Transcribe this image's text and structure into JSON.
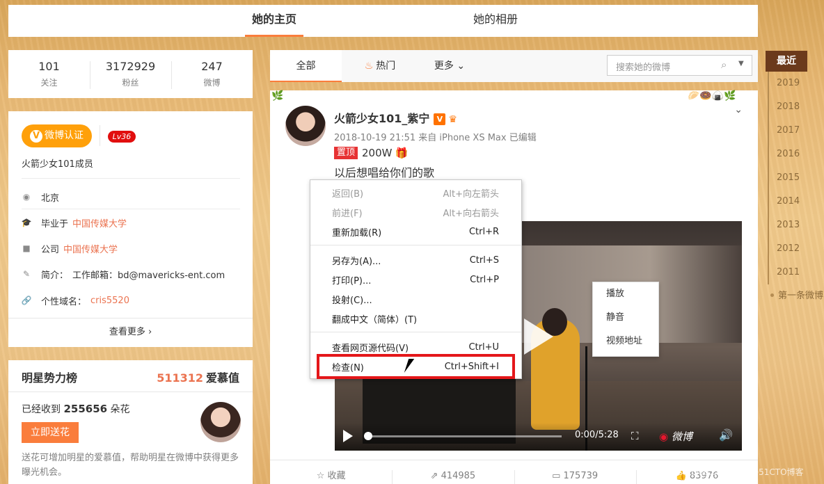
{
  "nav": {
    "tab_home": "她的主页",
    "tab_album": "她的相册"
  },
  "stats": [
    {
      "num": "101",
      "label": "关注"
    },
    {
      "num": "3172929",
      "label": "粉丝"
    },
    {
      "num": "247",
      "label": "微博"
    }
  ],
  "profile": {
    "badge": "微博认证",
    "badge_icon": "V",
    "level": "Lv36",
    "desc": "火箭少女101成员",
    "location": "北京",
    "edu_prefix": "毕业于",
    "edu_link": "中国传媒大学",
    "company_prefix": "公司",
    "company_link": "中国传媒大学",
    "intro_label": "简介：",
    "intro_value": "工作邮箱：bd@mavericks-ent.com",
    "domain_label": "个性域名：",
    "domain_value": "cris5520",
    "more": "查看更多"
  },
  "rank": {
    "title": "明星势力榜",
    "score": "511312",
    "score_unit": "爱慕值",
    "received_prefix": "已经收到",
    "received_num": "255656",
    "received_unit": "朵花",
    "send_button": "立即送花",
    "tip": "送花可增加明星的爱慕值，帮助明星在微博中获得更多曝光机会。"
  },
  "feed_tabs": {
    "all": "全部",
    "hot": "热门",
    "more": "更多"
  },
  "search": {
    "placeholder": "搜索她的微博"
  },
  "post": {
    "name": "火箭少女101_紫宁",
    "v": "V",
    "meta": "2018-10-19 21:51 来自 iPhone XS Max  已编辑",
    "pinned": "置顶",
    "count": "200W",
    "text": "以后想唱给你们的歌",
    "video_time": "0:00/5:28",
    "video_logo": "微博",
    "actions": [
      {
        "icon": "☆",
        "label": "收藏"
      },
      {
        "icon": "⇗",
        "label": "414985"
      },
      {
        "icon": "▭",
        "label": "175739"
      },
      {
        "icon": "👍",
        "label": "83976"
      }
    ]
  },
  "video_menu": [
    "播放",
    "静音",
    "视频地址"
  ],
  "context_menu": {
    "back": {
      "label": "返回(B)",
      "key": "Alt+向左箭头"
    },
    "forward": {
      "label": "前进(F)",
      "key": "Alt+向右箭头"
    },
    "reload": {
      "label": "重新加载(R)",
      "key": "Ctrl+R"
    },
    "saveas": {
      "label": "另存为(A)...",
      "key": "Ctrl+S"
    },
    "print": {
      "label": "打印(P)...",
      "key": "Ctrl+P"
    },
    "cast": {
      "label": "投射(C)..."
    },
    "translate": {
      "label": "翻成中文（简体）(T)"
    },
    "source": {
      "label": "查看网页源代码(V)",
      "key": "Ctrl+U"
    },
    "inspect": {
      "label": "检查(N)",
      "key": "Ctrl+Shift+I"
    }
  },
  "years": [
    "最近",
    "2019",
    "2018",
    "2017",
    "2016",
    "2015",
    "2014",
    "2013",
    "2012",
    "2011",
    "第一条微博"
  ],
  "watermark": "https://blog.csdn.net @51CTO博客",
  "colors": {
    "accent": "#fa7d3c",
    "link": "#eb7350",
    "highlight": "#e4171a"
  }
}
